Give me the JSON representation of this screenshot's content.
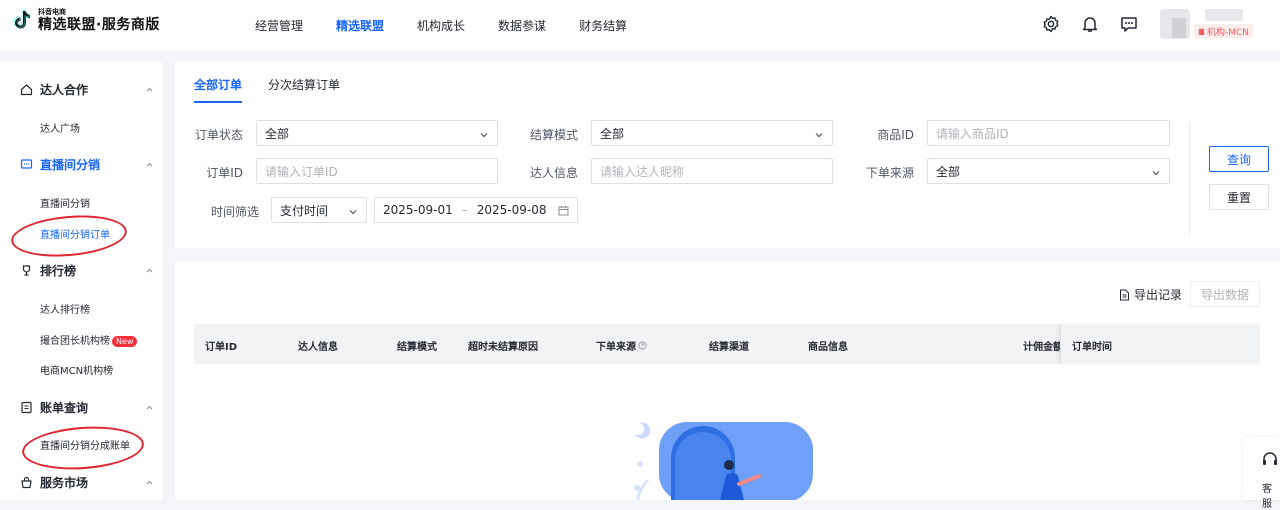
{
  "brand": {
    "small": "抖音电商",
    "main": "精选联盟·服务商版"
  },
  "nav": [
    {
      "label": "经营管理"
    },
    {
      "label": "精选联盟"
    },
    {
      "label": "机构成长"
    },
    {
      "label": "数据参谋"
    },
    {
      "label": "财务结算"
    }
  ],
  "user": {
    "role": "机构-MCN"
  },
  "sidebar": {
    "groups": [
      {
        "title": "达人合作",
        "items": [
          "达人广场"
        ]
      },
      {
        "title": "直播间分销",
        "items": [
          "直播间分销",
          "直播间分销订单"
        ]
      },
      {
        "title": "排行榜",
        "items": [
          "达人排行榜",
          "撮合团长机构榜",
          "电商MCN机构榜"
        ],
        "badge": "New"
      },
      {
        "title": "账单查询",
        "items": [
          "直播间分销分成账单"
        ]
      },
      {
        "title": "服务市场",
        "items": []
      }
    ]
  },
  "tabs": [
    "全部订单",
    "分次结算订单"
  ],
  "filters": {
    "order_status": {
      "label": "订单状态",
      "value": "全部"
    },
    "settle_mode": {
      "label": "结算模式",
      "value": "全部"
    },
    "product_id": {
      "label": "商品ID",
      "placeholder": "请输入商品ID"
    },
    "order_id": {
      "label": "订单ID",
      "placeholder": "请输入订单ID"
    },
    "talent_info": {
      "label": "达人信息",
      "placeholder": "请输入达人昵称"
    },
    "order_source": {
      "label": "下单来源",
      "value": "全部"
    },
    "time_filter": {
      "label": "时间筛选",
      "type": "支付时间",
      "start": "2025-09-01",
      "sep": "–",
      "end": "2025-09-08"
    }
  },
  "buttons": {
    "query": "查询",
    "reset": "重置",
    "export_log": "导出记录",
    "export_data": "导出数据"
  },
  "table": {
    "columns": [
      "订单ID",
      "达人信息",
      "结算模式",
      "超时未结算原因",
      "下单来源",
      "结算渠道",
      "商品信息",
      "计佣金额",
      "订单时间"
    ]
  },
  "help": {
    "label": "客服"
  },
  "colors": {
    "accent": "#1966ff",
    "annotation": "#e0262f"
  }
}
